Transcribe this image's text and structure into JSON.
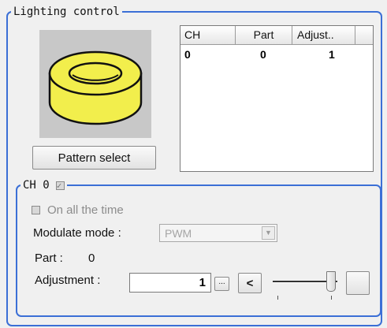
{
  "group": {
    "title": "Lighting control"
  },
  "pattern": {
    "select_label": "Pattern select"
  },
  "table": {
    "columns": [
      "CH",
      "Part",
      "Adjust.."
    ],
    "rows": [
      {
        "ch": "0",
        "part": "0",
        "adjust": "1"
      }
    ]
  },
  "channel": {
    "title": "CH 0",
    "always_on_label": "On all the time",
    "modulate_label": "Modulate mode :",
    "modulate_value": "PWM",
    "part_label": "Part :",
    "part_value": "0",
    "adjust_label": "Adjustment :",
    "adjust_value": "1",
    "ellipsis_label": "...",
    "decrement_label": "<",
    "slider_level": 1.0
  },
  "icons": {
    "lighting_ring": "ring-light-icon",
    "select_arrow": "chevron-down-icon"
  },
  "colors": {
    "group_border": "#3b6fd6",
    "ring_fill": "#f2ee4c",
    "preview_bg": "#c8c8c8"
  }
}
